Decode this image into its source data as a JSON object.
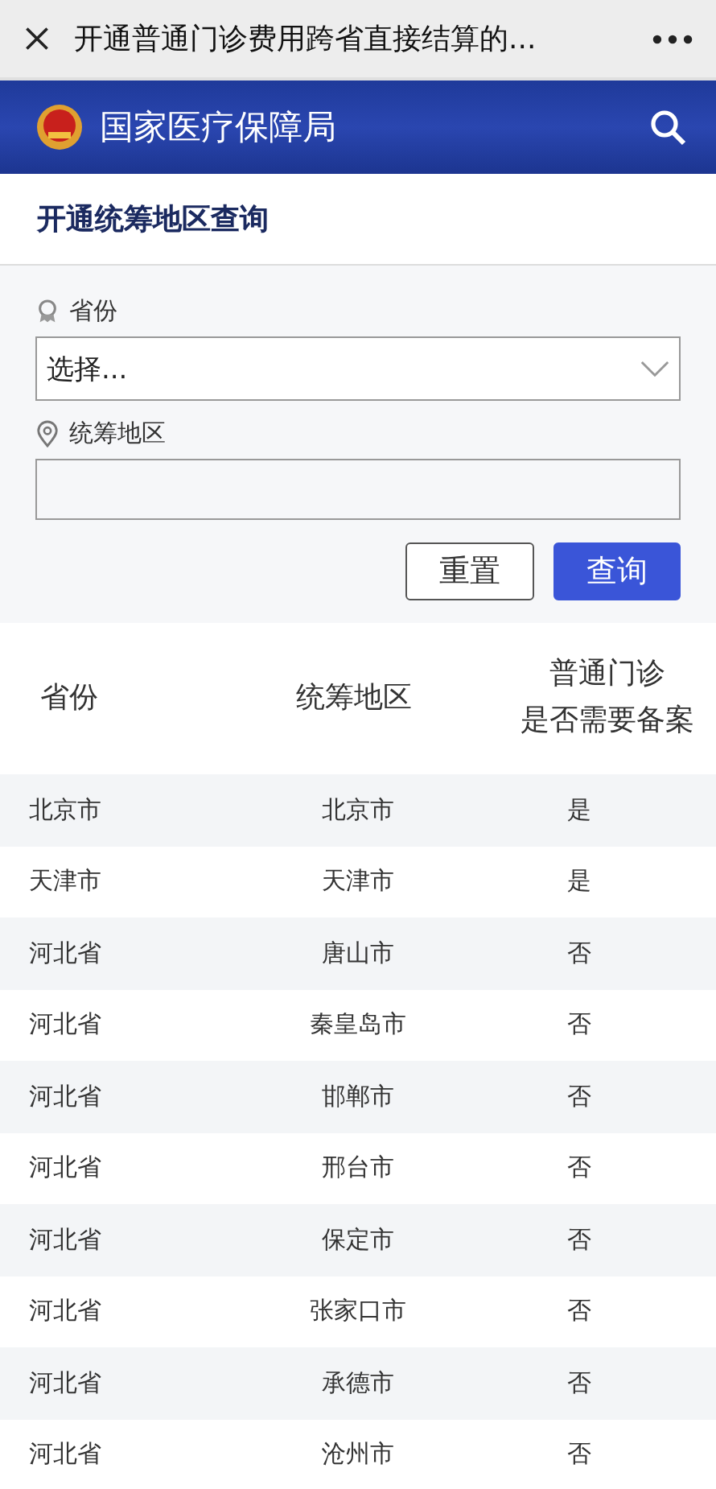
{
  "top_bar": {
    "title": "开通普通门诊费用跨省直接结算的..."
  },
  "banner": {
    "title": "国家医疗保障局"
  },
  "section_title": "开通统筹地区查询",
  "form": {
    "province_label": "省份",
    "province_value": "选择...",
    "region_label": "统筹地区",
    "buttons": [
      {
        "label": "重置",
        "kind": "secondary"
      },
      {
        "label": "查询",
        "kind": "primary"
      }
    ]
  },
  "table": {
    "columns": [
      "省份",
      "统筹地区",
      "普通门诊是否需要备案"
    ],
    "rows": [
      [
        "北京市",
        "北京市",
        "是"
      ],
      [
        "天津市",
        "天津市",
        "是"
      ],
      [
        "河北省",
        "唐山市",
        "否"
      ],
      [
        "河北省",
        "秦皇岛市",
        "否"
      ],
      [
        "河北省",
        "邯郸市",
        "否"
      ],
      [
        "河北省",
        "邢台市",
        "否"
      ],
      [
        "河北省",
        "保定市",
        "否"
      ],
      [
        "河北省",
        "张家口市",
        "否"
      ],
      [
        "河北省",
        "承德市",
        "否"
      ],
      [
        "河北省",
        "沧州市",
        "否"
      ]
    ]
  }
}
